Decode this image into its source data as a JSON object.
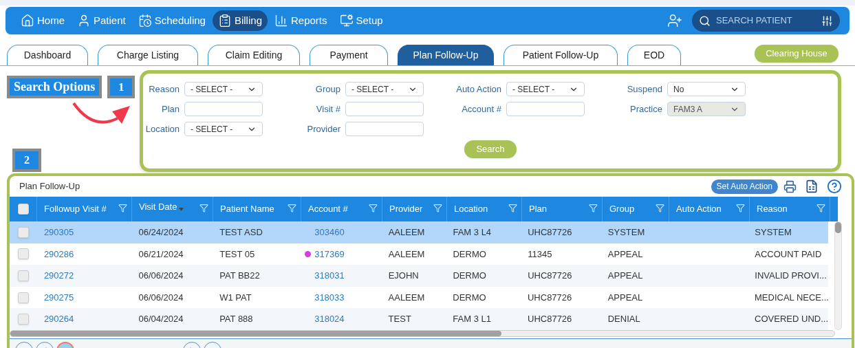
{
  "nav": {
    "items": [
      {
        "label": "Home",
        "selected": false
      },
      {
        "label": "Patient",
        "selected": false
      },
      {
        "label": "Scheduling",
        "selected": false
      },
      {
        "label": "Billing",
        "selected": true
      },
      {
        "label": "Reports",
        "selected": false
      },
      {
        "label": "Setup",
        "selected": false
      }
    ],
    "search": {
      "placeholder": "SEARCH PATIENT"
    }
  },
  "tabs": [
    {
      "label": "Dashboard",
      "selected": false
    },
    {
      "label": "Charge Listing",
      "selected": false
    },
    {
      "label": "Claim Editing",
      "selected": false
    },
    {
      "label": "Payment",
      "selected": false
    },
    {
      "label": "Plan Follow-Up",
      "selected": true
    },
    {
      "label": "Patient Follow-Up",
      "selected": false
    },
    {
      "label": "EOD",
      "selected": false
    }
  ],
  "clearing_house_button": "Clearing House",
  "callouts": {
    "search_options": "Search Options",
    "marker_1": "1",
    "marker_2": "2"
  },
  "search_form": {
    "columns": [
      [
        {
          "label": "Reason",
          "kind": "select",
          "value": "- SELECT -"
        },
        {
          "label": "Plan",
          "kind": "text"
        },
        {
          "label": "Location",
          "kind": "select",
          "value": "- SELECT -"
        }
      ],
      [
        {
          "label": "Group",
          "kind": "select",
          "value": "- SELECT -"
        },
        {
          "label": "Visit #",
          "kind": "text"
        },
        {
          "label": "Provider",
          "kind": "text"
        }
      ],
      [
        {
          "label": "Auto Action",
          "kind": "select",
          "value": "- SELECT -"
        },
        {
          "label": "Account #",
          "kind": "text"
        }
      ],
      [
        {
          "label": "Suspend",
          "kind": "select",
          "value": "No",
          "disabled": false
        },
        {
          "label": "Practice",
          "kind": "select",
          "value": "FAM3 A",
          "disabled": true
        }
      ]
    ],
    "search_button": "Search"
  },
  "grid": {
    "title": "Plan Follow-Up",
    "set_auto_action_button": "Set Auto Action",
    "header_checked": false,
    "columns": [
      {
        "label": "Followup Visit #",
        "sorted": false
      },
      {
        "label": "Visit Date",
        "sorted": true
      },
      {
        "label": "Patient Name",
        "sorted": false
      },
      {
        "label": "Account #",
        "sorted": false
      },
      {
        "label": "Provider",
        "sorted": false
      },
      {
        "label": "Location",
        "sorted": false
      },
      {
        "label": "Plan",
        "sorted": false
      },
      {
        "label": "Group",
        "sorted": false
      },
      {
        "label": "Auto Action",
        "sorted": false
      },
      {
        "label": "Reason",
        "sorted": false
      }
    ],
    "rows": [
      {
        "selected": true,
        "checked": false,
        "cells": [
          "290305",
          "06/24/2024",
          "TEST ASD",
          "303460",
          "AALEEM",
          "FAM 3 L4",
          "UHC87726",
          "SYSTEM",
          "",
          "SYSTEM"
        ]
      },
      {
        "selected": false,
        "checked": false,
        "color": "#d63be6",
        "cells": [
          "290286",
          "06/21/2024",
          "TEST 05",
          "317369",
          "AALEEM",
          "DERMO",
          "11345",
          "APPEAL",
          "",
          "ACCOUNT PAID"
        ]
      },
      {
        "selected": false,
        "checked": false,
        "cells": [
          "290272",
          "06/06/2024",
          "PAT BB22",
          "318031",
          "EJOHN",
          "DERMO",
          "UHC87726",
          "APPEAL",
          "",
          "INVALID PROVI..."
        ]
      },
      {
        "selected": false,
        "checked": false,
        "cells": [
          "290275",
          "06/06/2024",
          "W1 PAT",
          "318033",
          "AALEEM",
          "DERMO",
          "UHC87726",
          "APPEAL",
          "",
          "MEDICAL NECE..."
        ]
      },
      {
        "selected": false,
        "checked": false,
        "cells": [
          "290264",
          "06/04/2024",
          "PAT 888",
          "318024",
          "TEST",
          "FAM 3 L1",
          "UHC87726",
          "DENIAL",
          "",
          "COVERED UND..."
        ]
      }
    ]
  }
}
